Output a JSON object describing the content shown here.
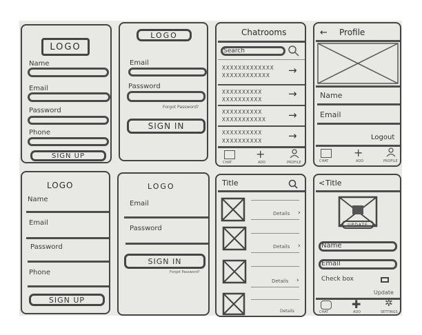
{
  "signup1": {
    "logo": "LOGO",
    "name": "Name",
    "email": "Email",
    "password": "Password",
    "phone": "Phone",
    "button": "SIGN UP"
  },
  "signin1": {
    "logo": "LOGO",
    "email": "Email",
    "password": "Password",
    "forgot": "Forgot Password?",
    "button": "SIGN IN"
  },
  "chatrooms": {
    "title": "Chatrooms",
    "search_placeholder": "Search",
    "rows": [
      {
        "line1": "XXXXXXXXXXXXX",
        "line2": "XXXXXXXXXXXX"
      },
      {
        "line1": "XXXXXXXXXX",
        "line2": "XXXXXXXXXX"
      },
      {
        "line1": "XXXXXXXXXX",
        "line2": "XXXXXXXXXXX"
      },
      {
        "line1": "XXXXXXXXXX",
        "line2": "XXXXXXXXXX"
      }
    ],
    "nav": [
      "CHAT",
      "ADD",
      "PROFILE"
    ]
  },
  "profile": {
    "back": "←",
    "title": "Profile",
    "name": "Name",
    "email": "Email",
    "logout": "Logout",
    "nav": [
      "CHAT",
      "ADD",
      "PROFILE"
    ]
  },
  "signup2": {
    "logo": "LOGO",
    "name": "Name",
    "email": "Email",
    "password": "Password",
    "phone": "Phone",
    "button": "SIGN UP"
  },
  "signin2": {
    "logo": "LOGO",
    "email": "Email",
    "password": "Password",
    "forgot": "Forgot Password?",
    "button": "SIGN IN"
  },
  "list": {
    "title": "Title",
    "details": [
      "Details",
      "Details",
      "Details",
      "Details"
    ]
  },
  "edit": {
    "back": "<",
    "title": "Title",
    "update": "UPDATE",
    "name": "Name",
    "email": "Email",
    "checkbox": "Check box",
    "update_link": "Update",
    "nav": [
      "CHAT",
      "ADD",
      "SETTINGS"
    ]
  }
}
